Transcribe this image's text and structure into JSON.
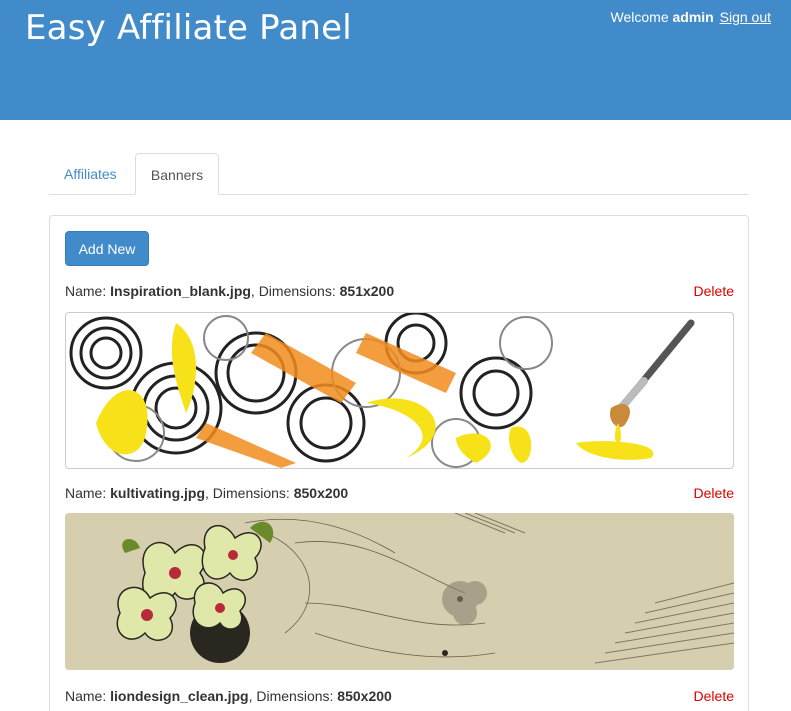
{
  "header": {
    "title": "Easy Affiliate Panel",
    "welcome_text": "Welcome",
    "username": "admin",
    "signout_label": "Sign out"
  },
  "tabs": [
    {
      "label": "Affiliates",
      "active": false
    },
    {
      "label": "Banners",
      "active": true
    }
  ],
  "panel": {
    "add_button_label": "Add New"
  },
  "banners": [
    {
      "name_label": "Name:",
      "name": "Inspiration_blank.jpg",
      "dims_label": ", Dimensions:",
      "dimensions": "851x200",
      "delete_label": "Delete"
    },
    {
      "name_label": "Name:",
      "name": "kultivating.jpg",
      "dims_label": ", Dimensions:",
      "dimensions": "850x200",
      "delete_label": "Delete"
    },
    {
      "name_label": "Name:",
      "name": "liondesign_clean.jpg",
      "dims_label": ", Dimensions:",
      "dimensions": "850x200",
      "delete_label": "Delete"
    }
  ],
  "colors": {
    "header_bg": "#428bca",
    "primary_button": "#428bca",
    "delete_link": "#dd0000"
  }
}
